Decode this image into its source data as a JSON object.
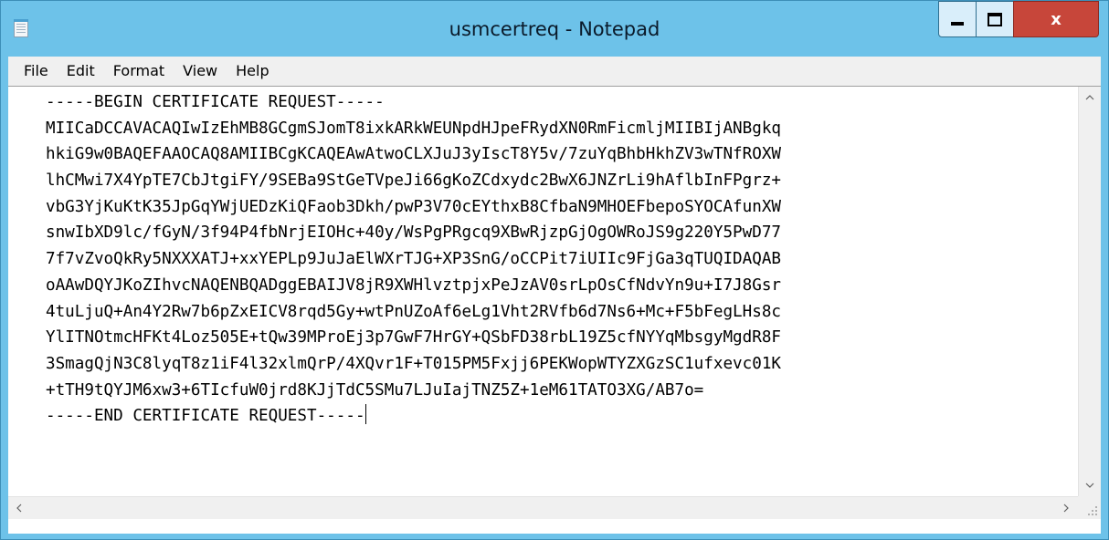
{
  "window": {
    "title": "usmcertreq - Notepad",
    "close_glyph": "x"
  },
  "menu": {
    "items": [
      "File",
      "Edit",
      "Format",
      "View",
      "Help"
    ]
  },
  "document": {
    "lines": [
      "-----BEGIN CERTIFICATE REQUEST-----",
      "MIICaDCCAVACAQIwIzEhMB8GCgmSJomT8ixkARkWEUNpdHJpeFRydXN0RmFicmljMIIBIjANBgkq",
      "hkiG9w0BAQEFAAOCAQ8AMIIBCgKCAQEAwAtwoCLXJuJ3yIscT8Y5v/7zuYqBhbHkhZV3wTNfROXW",
      "lhCMwi7X4YpTE7CbJtgiFY/9SEBa9StGeTVpeJi66gKoZCdxydc2BwX6JNZrLi9hAflbInFPgrz+",
      "vbG3YjKuKtK35JpGqYWjUEDzKiQFaob3Dkh/pwP3V70cEYthxB8CfbaN9MHOEFbepoSYOCAfunXW",
      "snwIbXD9lc/fGyN/3f94P4fbNrjEIOHc+40y/WsPgPRgcq9XBwRjzpGjOgOWRoJS9g220Y5PwD77",
      "7f7vZvoQkRy5NXXXATJ+xxYEPLp9JuJaElWXrTJG+XP3SnG/oCCPit7iUIIc9FjGa3qTUQIDAQAB",
      "oAAwDQYJKoZIhvcNAQENBQADggEBAIJV8jR9XWHlvztpjxPeJzAV0srLpOsCfNdvYn9u+I7J8Gsr",
      "4tuLjuQ+An4Y2Rw7b6pZxEICV8rqd5Gy+wtPnUZoAf6eLg1Vht2RVfb6d7Ns6+Mc+F5bFegLHs8c",
      "YlITNOtmcHFKt4Loz505E+tQw39MProEj3p7GwF7HrGY+QSbFD38rbL19Z5cfNYYqMbsgyMgdR8F",
      "3SmagQjN3C8lyqT8z1iF4l32xlmQrP/4XQvr1F+T015PM5Fxjj6PEKWopWTYZXGzSC1ufxevc01K",
      "+tTH9tQYJM6xw3+6TIcfuW0jrd8KJjTdC5SMu7LJuIajTNZ5Z+1eM61TATO3XG/AB7o=",
      "-----END CERTIFICATE REQUEST-----"
    ]
  }
}
